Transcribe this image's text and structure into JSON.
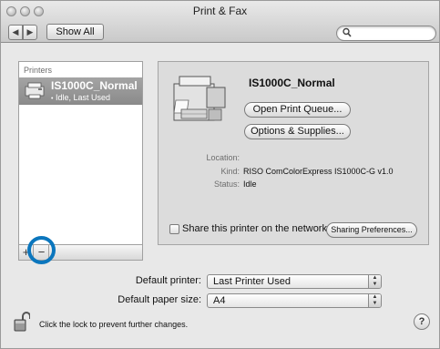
{
  "window": {
    "title": "Print & Fax"
  },
  "toolbar": {
    "back_glyph": "◀",
    "forward_glyph": "▶",
    "show_all_label": "Show All",
    "search_placeholder": "",
    "search_glyph": "🔍"
  },
  "printers": {
    "header": "Printers",
    "items": [
      {
        "name": "IS1000C_Normal",
        "status": "Idle, Last Used"
      }
    ],
    "add_glyph": "+",
    "remove_glyph": "−"
  },
  "detail": {
    "name": "IS1000C_Normal",
    "open_queue_label": "Open Print Queue...",
    "options_label": "Options & Supplies...",
    "location_label": "Location:",
    "location_value": "",
    "kind_label": "Kind:",
    "kind_value": "RISO ComColorExpress IS1000C-G v1.0",
    "status_label": "Status:",
    "status_value": "Idle",
    "share_label": "Share this printer on the network",
    "share_checked": false,
    "sharing_prefs_label": "Sharing Preferences..."
  },
  "defaults": {
    "printer_label": "Default printer:",
    "printer_value": "Last Printer Used",
    "paper_label": "Default paper size:",
    "paper_value": "A4"
  },
  "footer": {
    "lock_text": "Click the lock to prevent further changes.",
    "help_label": "?"
  },
  "colors": {
    "highlight_ring": "#0b76bd",
    "selected_row": "#999999"
  }
}
